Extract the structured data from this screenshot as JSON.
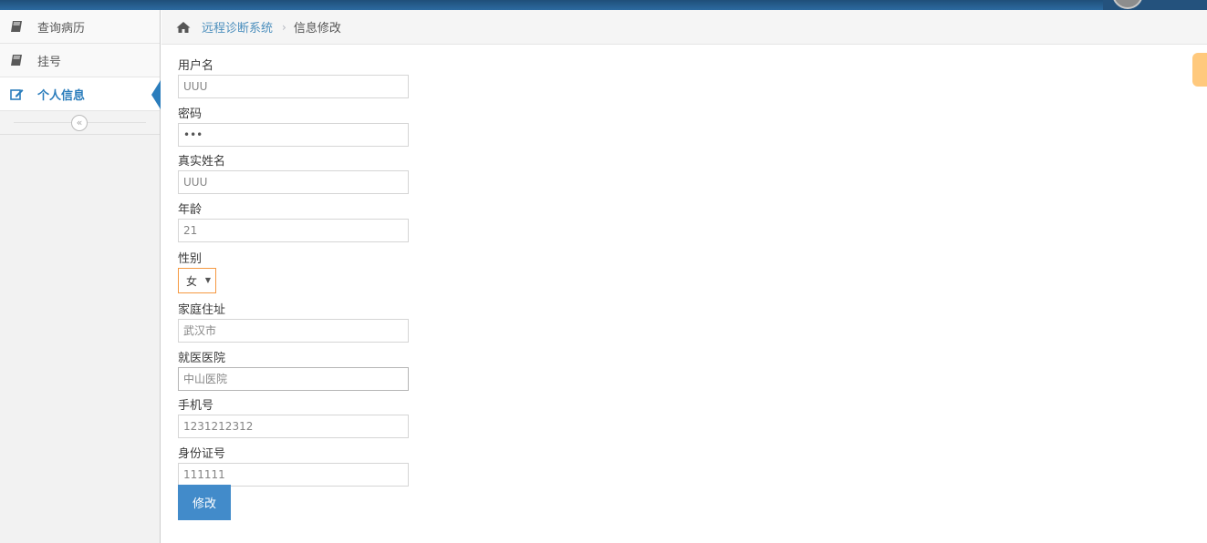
{
  "sidebar": {
    "items": [
      {
        "label": "查询病历",
        "icon": "book-icon"
      },
      {
        "label": "挂号",
        "icon": "book-icon"
      },
      {
        "label": "个人信息",
        "icon": "edit-icon",
        "active": true
      }
    ],
    "collapse_label": "«"
  },
  "breadcrumb": {
    "home": "远程诊断系统",
    "separator": "›",
    "current": "信息修改"
  },
  "form": {
    "username": {
      "label": "用户名",
      "value": "UUU"
    },
    "password": {
      "label": "密码",
      "value": "•••"
    },
    "realname": {
      "label": "真实姓名",
      "value": "UUU"
    },
    "age": {
      "label": "年龄",
      "value": "21"
    },
    "gender": {
      "label": "性别",
      "value": "女"
    },
    "address": {
      "label": "家庭住址",
      "value": "武汉市"
    },
    "hospital": {
      "label": "就医医院",
      "value": "中山医院"
    },
    "phone": {
      "label": "手机号",
      "value": "1231212312"
    },
    "idcard": {
      "label": "身份证号",
      "value": "111111"
    },
    "submit_label": "修改"
  },
  "colors": {
    "accent": "#2b7dbc",
    "button": "#428bca",
    "topbar": "#2c6aa0",
    "settings_tab": "#ffb752"
  }
}
